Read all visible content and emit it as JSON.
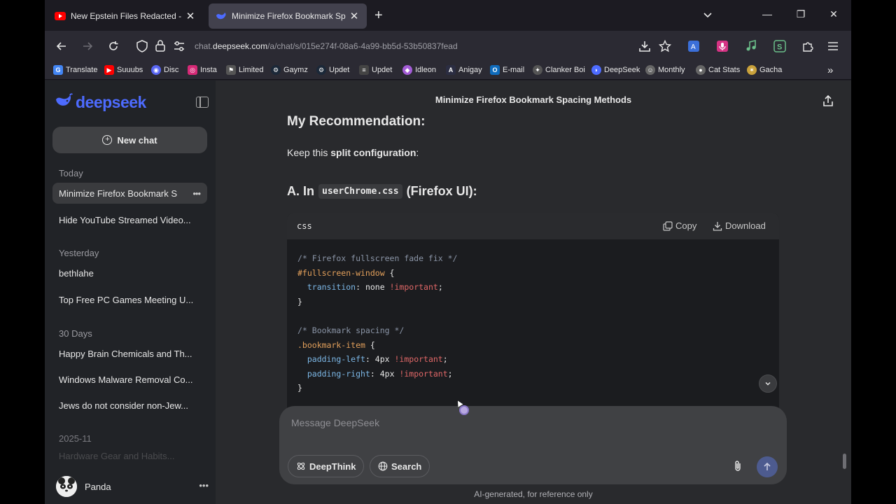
{
  "browser": {
    "tabs": [
      {
        "title": "New Epstein Files Redacted - YouTube",
        "favicon": "youtube-icon",
        "active": false
      },
      {
        "title": "Minimize Firefox Bookmark Spacing M",
        "favicon": "deepseek-icon",
        "active": true
      }
    ],
    "url_prefix": "chat.",
    "url_domain": "deepseek.com",
    "url_path": "/a/chat/s/015e274f-08a6-4a99-bb5d-53b50837fead",
    "bookmarks": [
      {
        "label": "Translate",
        "icon": "translate-icon",
        "color": "#4285f4"
      },
      {
        "label": "Suuubs",
        "icon": "youtube-icon",
        "color": "#ff0000"
      },
      {
        "label": "Disc",
        "icon": "discord-icon",
        "color": "#5865f2"
      },
      {
        "label": "Insta",
        "icon": "instagram-icon",
        "color": "#d62976"
      },
      {
        "label": "Limited",
        "icon": "limited-icon",
        "color": "#d0d0d0"
      },
      {
        "label": "Gaymz",
        "icon": "steam-icon",
        "color": "#9fb6cc"
      },
      {
        "label": "Updet",
        "icon": "steam-icon",
        "color": "#9fb6cc"
      },
      {
        "label": "Updet",
        "icon": "stack-icon",
        "color": "#e8e8e8"
      },
      {
        "label": "Idleon",
        "icon": "idleon-icon",
        "color": "#a35cd6"
      },
      {
        "label": "Anigay",
        "icon": "anilist-icon",
        "color": "#2b2d42"
      },
      {
        "label": "E-mail",
        "icon": "outlook-icon",
        "color": "#0f6cbd"
      },
      {
        "label": "Clanker Boi",
        "icon": "gear-icon",
        "color": "#cfcfcf"
      },
      {
        "label": "DeepSeek",
        "icon": "deepseek-icon",
        "color": "#4d6bfe"
      },
      {
        "label": "Monthly",
        "icon": "monthly-icon",
        "color": "#e8e8e8"
      },
      {
        "label": "Cat Stats",
        "icon": "cat-icon",
        "color": "#e8e8e8"
      },
      {
        "label": "Gacha",
        "icon": "gacha-icon",
        "color": "#c9a13b"
      }
    ]
  },
  "app": {
    "logo_text": "deepseek",
    "new_chat_label": "New chat",
    "chat_title": "Minimize Firefox Bookmark Spacing Methods",
    "history": {
      "today_label": "Today",
      "today": [
        "Minimize Firefox Bookmark S",
        "Hide YouTube Streamed Video..."
      ],
      "yesterday_label": "Yesterday",
      "yesterday": [
        "bethlahe",
        "Top Free PC Games Meeting U..."
      ],
      "days30_label": "30 Days",
      "days30": [
        "Happy Brain Chemicals and Th...",
        "Windows Malware Removal Co...",
        "Jews do not consider non-Jew..."
      ],
      "month_label": "2025-11",
      "month": [
        "Hardware Gear and Habits..."
      ]
    },
    "profile_name": "Panda"
  },
  "message": {
    "heading": "My Recommendation:",
    "keep_prefix": "Keep this ",
    "keep_bold": "split configuration",
    "keep_suffix": ":",
    "section_prefix": "A. In",
    "section_code": "userChrome.css",
    "section_suffix": "(Firefox UI):",
    "code_lang": "css",
    "copy_label": "Copy",
    "download_label": "Download"
  },
  "composer": {
    "placeholder": "Message DeepSeek",
    "deepthink_label": "DeepThink",
    "search_label": "Search"
  },
  "disclaimer": "AI-generated, for reference only",
  "colors": {
    "brand": "#4d6bfe",
    "accent_send": "#4d5b8f"
  }
}
